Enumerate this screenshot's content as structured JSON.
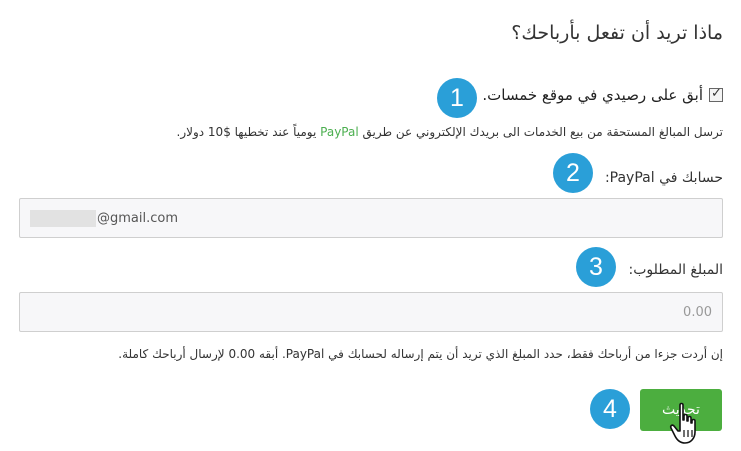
{
  "form": {
    "title": "ماذا تريد أن تفعل بأرباحك؟",
    "keep_balance_label": "أبق على رصيدي في موقع خمسات.",
    "keep_balance_checked": true,
    "auto_transfer_help_before": "ترسل المبالغ المستحقة من بيع الخدمات الى بريدك الإلكتروني عن طريق",
    "auto_transfer_help_paypal": "PayPal",
    "auto_transfer_help_after": "يومياً عند تخطيها $10 دولار.",
    "paypal_account_label": "حسابك في PayPal:",
    "paypal_email_value": "@gmail.com",
    "amount_label": "المبلغ المطلوب:",
    "amount_placeholder": "0.00",
    "amount_help": "إن أردت جزءا من أرباحك فقط، حدد المبلغ الذي تريد أن يتم إرساله لحسابك في PayPal. أبقه 0.00 لإرسال أرباحك كاملة.",
    "submit_label": "تحديث"
  },
  "annotations": {
    "badge_1": "1",
    "badge_2": "2",
    "badge_3": "3",
    "badge_4": "4",
    "badge_color": "#2a9fd8"
  },
  "colors": {
    "accent_green": "#4cae3f",
    "paypal_link": "#4caf50"
  }
}
